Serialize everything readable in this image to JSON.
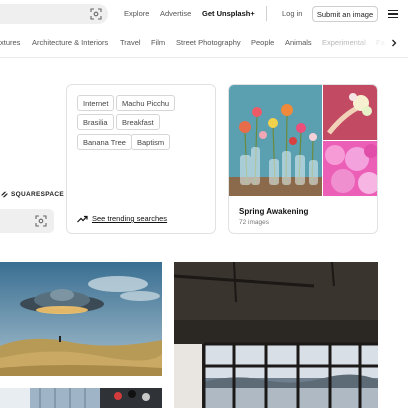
{
  "header": {
    "nav": [
      "Explore",
      "Advertise",
      "Get Unsplash+"
    ],
    "login": "Log in",
    "submit": "Submit an image"
  },
  "topics": {
    "items": [
      "xtures",
      "Architecture & Interiors",
      "Travel",
      "Film",
      "Street Photography",
      "People",
      "Animals",
      "Experimental",
      "Fa"
    ]
  },
  "sponsor": {
    "brand": "SQUARESPACE"
  },
  "trending": {
    "tags": [
      "Internet",
      "Machu Picchu",
      "Brasilia",
      "Breakfast",
      "Banana Tree",
      "Baptism"
    ],
    "link": "See trending searches"
  },
  "collection": {
    "title": "Spring Awakening",
    "count": "72 images"
  },
  "icons": {
    "visual_search": "scan-icon",
    "menu": "hamburger-menu-icon",
    "topics_next": "chevron-right-icon",
    "trending": "trending-up-icon",
    "sponsor": "squarespace-logo-icon"
  },
  "colors": {
    "search_bg": "#efefef",
    "border": "#e2e2e2",
    "text": "#111111",
    "muted": "#555555"
  }
}
